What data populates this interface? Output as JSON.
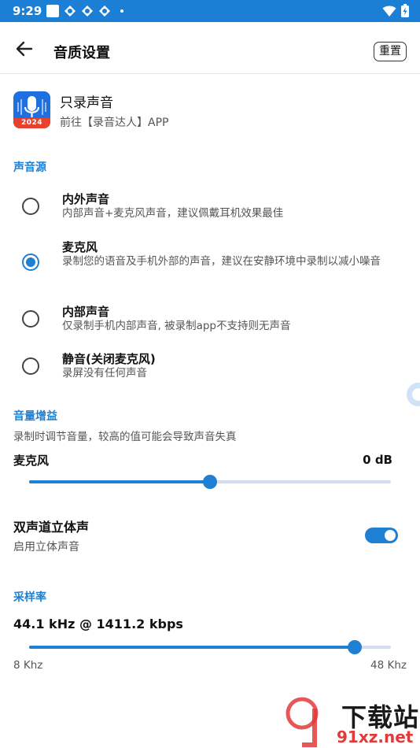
{
  "status_bar": {
    "time": "9:29"
  },
  "app_bar": {
    "title": "音质设置",
    "reset_label": "重置"
  },
  "promo": {
    "title": "只录声音",
    "subtitle": "前往【录音达人】APP",
    "logo_text": "2024"
  },
  "sound_source": {
    "heading": "声音源",
    "options": [
      {
        "title": "内外声音",
        "desc": "内部声音+麦克风声音，建议佩戴耳机效果最佳",
        "selected": false
      },
      {
        "title": "麦克风",
        "desc": "录制您的语音及手机外部的声音，建议在安静环境中录制以减小噪音",
        "selected": true
      },
      {
        "title": "内部声音",
        "desc": "仅录制手机内部声音, 被录制app不支持则无声音",
        "selected": false
      },
      {
        "title": "静音(关闭麦克风)",
        "desc": "录屏没有任何声音",
        "selected": false
      }
    ]
  },
  "volume_gain": {
    "heading": "音量增益",
    "desc": "录制时调节音量，较高的值可能会导致声音失真",
    "label": "麦克风",
    "value_text": "0 dB",
    "level": 0.5
  },
  "stereo": {
    "title": "双声道立体声",
    "subtitle": "启用立体声音",
    "enabled": true
  },
  "sample_rate": {
    "heading": "采样率",
    "value_text": "44.1 kHz @ 1411.2 kbps",
    "min_label": "8 Khz",
    "max_label": "48 Khz",
    "level": 0.9
  },
  "watermark": {
    "text": "下载站",
    "url_text": "91xz.net"
  },
  "colors": {
    "accent": "#1e7fd3",
    "status_bar": "#1b7fd6"
  }
}
